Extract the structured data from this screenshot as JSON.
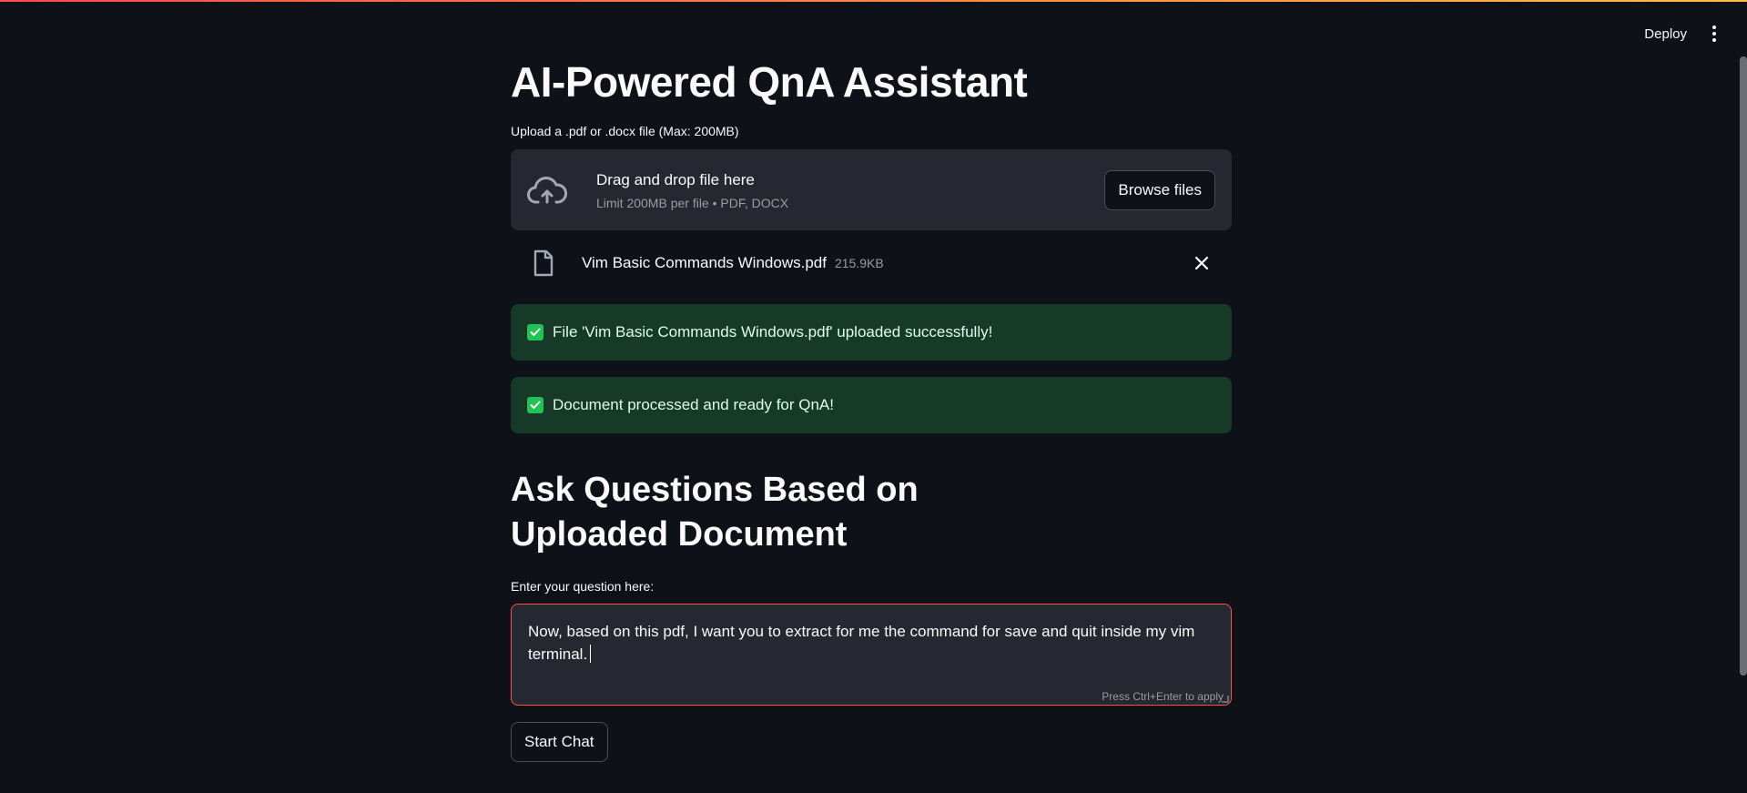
{
  "header": {
    "deploy_label": "Deploy",
    "menu_icon": "kebab-menu-icon"
  },
  "main": {
    "title": "AI-Powered QnA Assistant",
    "upload": {
      "label": "Upload a .pdf or .docx file (Max: 200MB)",
      "dropzone_title": "Drag and drop file here",
      "dropzone_subtitle": "Limit 200MB per file • PDF, DOCX",
      "browse_label": "Browse files",
      "icon": "cloud-upload-icon"
    },
    "uploaded_file": {
      "name": "Vim Basic Commands Windows.pdf",
      "size": "215.9KB",
      "icon": "file-icon"
    },
    "alerts": [
      {
        "text": "File 'Vim Basic Commands Windows.pdf' uploaded successfully!",
        "icon": "check-box-icon"
      },
      {
        "text": "Document processed and ready for QnA!",
        "icon": "check-box-icon"
      }
    ],
    "subheader": "Ask Questions Based on Uploaded Document",
    "question": {
      "label": "Enter your question here:",
      "value": "Now, based on this pdf, I want you to extract for me the command for save and quit inside my vim terminal.",
      "hint": "Press Ctrl+Enter to apply"
    },
    "start_chat_label": "Start Chat"
  },
  "colors": {
    "background": "#0e1117",
    "panel": "#262730",
    "success_bg": "#173928",
    "success_check": "#21c354",
    "focus_border": "#ff4b4b"
  }
}
